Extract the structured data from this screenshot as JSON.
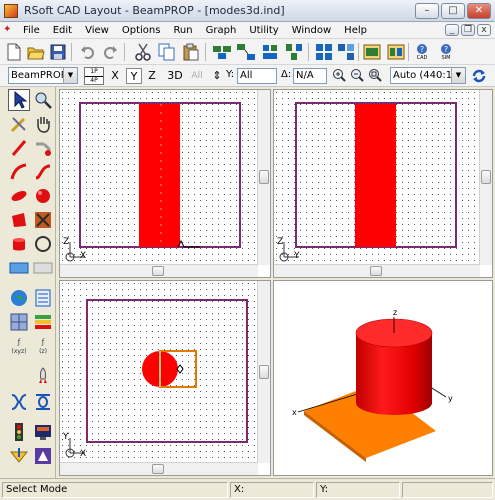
{
  "window": {
    "title": "RSoft CAD Layout - BeamPROP - [modes3d.ind]",
    "minimize": "–",
    "maximize": "□",
    "close": "✕",
    "mdi_minimize": "_",
    "mdi_restore": "❐",
    "mdi_close": "x"
  },
  "menu": {
    "items": [
      "File",
      "Edit",
      "View",
      "Options",
      "Run",
      "Graph",
      "Utility",
      "Window",
      "Help"
    ]
  },
  "toolbar1": {
    "icons": [
      "new-file-icon",
      "open-folder-icon",
      "save-icon",
      "undo-icon",
      "redo-icon",
      "cut-icon",
      "copy-icon",
      "paste-icon",
      "group-icon",
      "ungroup-icon",
      "align-icon",
      "arrange-icon",
      "layout-icon",
      "select-all-icon",
      "properties-icon",
      "distribute-icon",
      "cad-info-icon",
      "sim-info-icon"
    ],
    "cad_label": "CAD",
    "sim_label": "SIM"
  },
  "toolbar2": {
    "simulator": "BeamPROP",
    "bp_top": "1P",
    "bp_bottom": "4P",
    "axis_x": "X",
    "axis_y": "Y",
    "axis_z": "Z",
    "view_3d": "3D",
    "view_all": "All",
    "y_label": "Y:",
    "y_value": "All",
    "delta_label": "Δ:",
    "delta_value": "N/A",
    "zoom_mode": "Auto (440:1)"
  },
  "views": {
    "top_left_axes": {
      "vertical": "Z",
      "horizontal": "X"
    },
    "top_right_axes": {
      "vertical": "Z",
      "horizontal": "Y"
    },
    "bottom_left_axes": {
      "vertical": "Y",
      "horizontal": "X"
    },
    "view3d_axes": {
      "z": "z",
      "x": "x",
      "y": "y"
    }
  },
  "colors": {
    "waveguide": "#ff0000",
    "boundary": "#7b2a6e",
    "selection": "#e07a00",
    "substrate": "#ff8000"
  },
  "status": {
    "mode": "Select Mode",
    "x_label": "X:",
    "y_label": "Y:",
    "x_value": "",
    "y_value": ""
  }
}
